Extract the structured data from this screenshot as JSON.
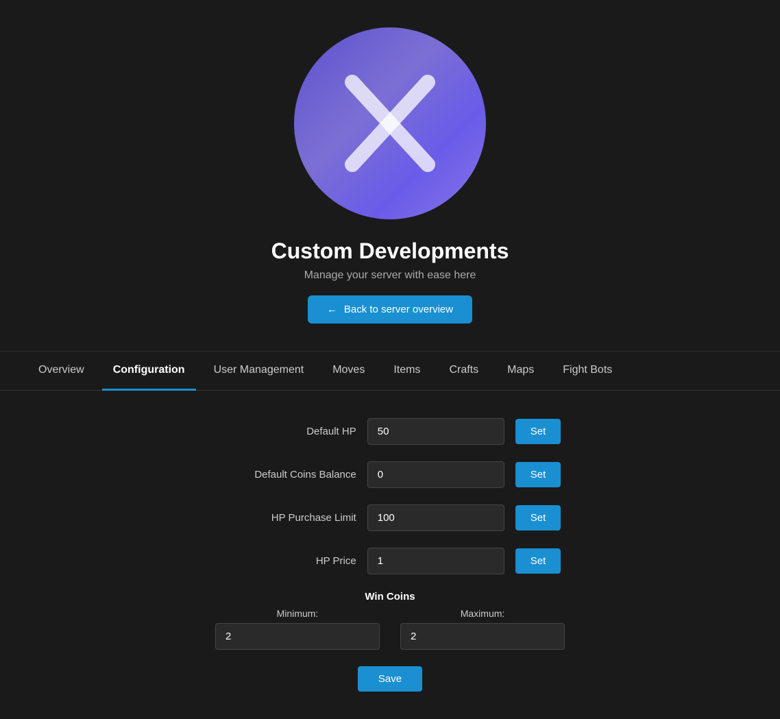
{
  "header": {
    "title": "Custom Developments",
    "subtitle": "Manage your server with ease here",
    "back_button_label": "Back to server overview"
  },
  "nav": {
    "tabs": [
      {
        "id": "overview",
        "label": "Overview",
        "active": false
      },
      {
        "id": "configuration",
        "label": "Configuration",
        "active": true
      },
      {
        "id": "user-management",
        "label": "User Management",
        "active": false
      },
      {
        "id": "moves",
        "label": "Moves",
        "active": false
      },
      {
        "id": "items",
        "label": "Items",
        "active": false
      },
      {
        "id": "crafts",
        "label": "Crafts",
        "active": false
      },
      {
        "id": "maps",
        "label": "Maps",
        "active": false
      },
      {
        "id": "fight-bots",
        "label": "Fight Bots",
        "active": false
      }
    ]
  },
  "config": {
    "default_hp_label": "Default HP",
    "default_hp_value": "50",
    "default_hp_set": "Set",
    "default_coins_label": "Default Coins Balance",
    "default_coins_value": "0",
    "default_coins_set": "Set",
    "hp_purchase_limit_label": "HP Purchase Limit",
    "hp_purchase_limit_value": "100",
    "hp_purchase_limit_set": "Set",
    "hp_price_label": "HP Price",
    "hp_price_value": "1",
    "hp_price_set": "Set",
    "win_coins_title": "Win Coins",
    "minimum_label": "Minimum:",
    "minimum_value": "2",
    "maximum_label": "Maximum:",
    "maximum_value": "2",
    "save_label": "Save"
  }
}
